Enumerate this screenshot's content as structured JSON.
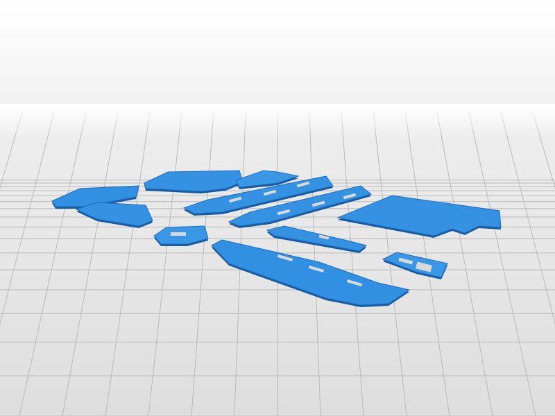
{
  "scene": {
    "description_label": "",
    "colors": {
      "background_top": "#ffffff",
      "background_horizon": "#f2f2f2",
      "floor": "#e8e8e8",
      "floor_grid": "#b9b9b9",
      "part_top": "#2f8fe0",
      "part_light": "#4aa3ee",
      "part_edge": "#1b64b0",
      "part_shadow": "#175aa0",
      "hole": "#e4e4e4"
    },
    "part_count": 12
  }
}
